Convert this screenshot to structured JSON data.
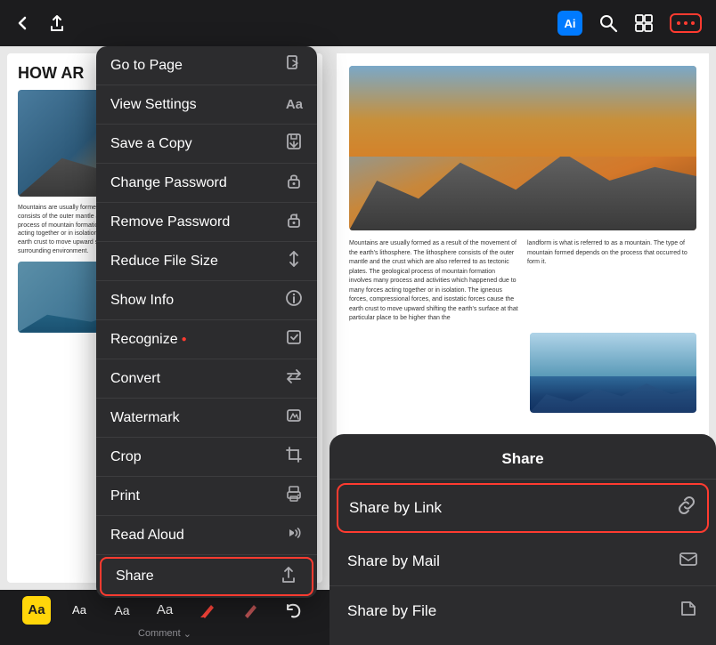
{
  "toolbar": {
    "back_icon": "‹",
    "share_icon": "↑",
    "ai_label": "Ai",
    "search_icon": "⌕",
    "view_icon": "⊞",
    "grid_icon": "⊟",
    "more_icon": "•••"
  },
  "menu": {
    "items": [
      {
        "id": "go-to-page",
        "label": "Go to Page",
        "icon": "→☐",
        "has_submenu": true
      },
      {
        "id": "view-settings",
        "label": "View Settings",
        "icon": "Aa",
        "has_submenu": true
      },
      {
        "id": "save-a-copy",
        "label": "Save a Copy",
        "icon": "⊡",
        "has_submenu": false
      },
      {
        "id": "change-password",
        "label": "Change Password",
        "icon": "🔓",
        "has_submenu": false
      },
      {
        "id": "remove-password",
        "label": "Remove Password",
        "icon": "🔒",
        "has_submenu": false
      },
      {
        "id": "reduce-file-size",
        "label": "Reduce File Size",
        "icon": "↕",
        "has_submenu": false
      },
      {
        "id": "show-info",
        "label": "Show Info",
        "icon": "ℹ",
        "has_submenu": false
      },
      {
        "id": "recognize",
        "label": "Recognize",
        "icon": "⊡",
        "has_dot": true,
        "has_submenu": false
      },
      {
        "id": "convert",
        "label": "Convert",
        "icon": "⇄",
        "has_submenu": false
      },
      {
        "id": "watermark",
        "label": "Watermark",
        "icon": "⊘",
        "has_submenu": false
      },
      {
        "id": "crop",
        "label": "Crop",
        "icon": "⊡",
        "has_submenu": false
      },
      {
        "id": "print",
        "label": "Print",
        "icon": "⊡",
        "has_submenu": false
      },
      {
        "id": "read-aloud",
        "label": "Read Aloud",
        "icon": "◁))",
        "has_submenu": false
      },
      {
        "id": "share",
        "label": "Share",
        "icon": "↑",
        "highlighted": true,
        "has_submenu": false
      }
    ]
  },
  "share_panel": {
    "title": "Share",
    "items": [
      {
        "id": "share-by-link",
        "label": "Share by Link",
        "icon": "🔗",
        "highlighted": true
      },
      {
        "id": "share-by-mail",
        "label": "Share by Mail",
        "icon": "✉"
      },
      {
        "id": "share-by-file",
        "label": "Share by File",
        "icon": "📁"
      }
    ]
  },
  "bottom_toolbar": {
    "comment_label": "Comment",
    "chevron": "⌄"
  },
  "doc": {
    "title": "HOW AR",
    "body_text": "Mountains are usually formed as a result of the movement of the earth's lithosphere. The lithosphere consists of the outer mantle and the crust which are also referred to as tectonic plates. The geological process of mountain formation involves many process and activities which happened due to many forces acting together or in isolation. The igneous forces, compressional forces, and isostatic forces cause the earth crust to move upward shifting the earth's surface at that particular place to be higher than the surrounding environment.",
    "right_text_col1": "Mountains are usually formed as a result of the movement of the earth's lithosphere. The lithosphere consists of the outer mantle and the crust which are also referred to as tectonic plates. The geological process of mountain formation involves many process and activities which happened due to many forces acting together or in isolation. The igneous forces, compressional forces, and isostatic forces cause the earth crust to move upward shifting the earth's surface at that particular place to be higher than the",
    "right_text_col2": "landform is what is referred to as a mountain. The type of mountain formed depends on the process that occurred to form it."
  }
}
